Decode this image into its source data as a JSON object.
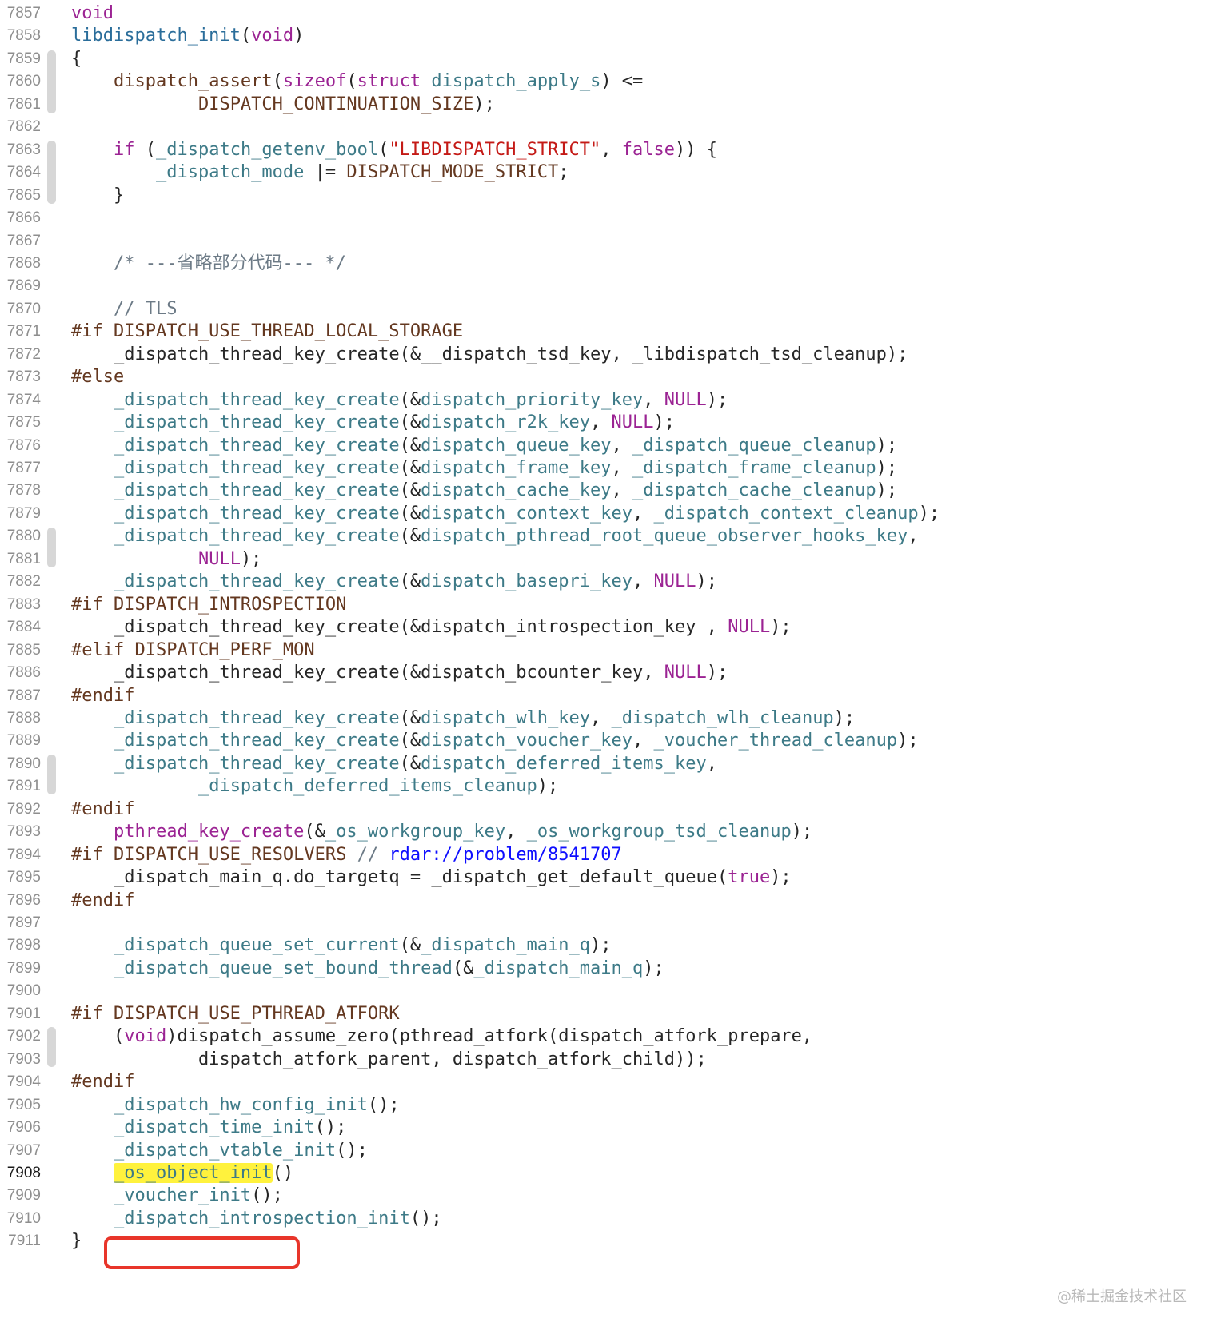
{
  "editor": {
    "current_line": "7908",
    "lines": [
      {
        "n": "7857",
        "t": [
          [
            "kw",
            "void"
          ]
        ]
      },
      {
        "n": "7858",
        "t": [
          [
            "blue",
            "libdispatch_init"
          ],
          [
            "tx",
            "("
          ],
          [
            "kw",
            "void"
          ],
          [
            "tx",
            ")"
          ]
        ]
      },
      {
        "n": "7859",
        "t": [
          [
            "tx",
            "{"
          ]
        ]
      },
      {
        "n": "7860",
        "t": [
          [
            "tx",
            "    "
          ],
          [
            "pp",
            "dispatch_assert"
          ],
          [
            "tx",
            "("
          ],
          [
            "kw",
            "sizeof"
          ],
          [
            "tx",
            "("
          ],
          [
            "kw",
            "struct"
          ],
          [
            "tx",
            " "
          ],
          [
            "fn",
            "dispatch_apply_s"
          ],
          [
            "tx",
            ") <="
          ]
        ]
      },
      {
        "n": "7861",
        "t": [
          [
            "tx",
            "            "
          ],
          [
            "pp",
            "DISPATCH_CONTINUATION_SIZE"
          ],
          [
            "tx",
            ");"
          ]
        ]
      },
      {
        "n": "7862",
        "t": []
      },
      {
        "n": "7863",
        "t": [
          [
            "tx",
            "    "
          ],
          [
            "kw",
            "if"
          ],
          [
            "tx",
            " ("
          ],
          [
            "fn",
            "_dispatch_getenv_bool"
          ],
          [
            "tx",
            "("
          ],
          [
            "str",
            "\"LIBDISPATCH_STRICT\""
          ],
          [
            "tx",
            ", "
          ],
          [
            "kw",
            "false"
          ],
          [
            "tx",
            ")) {"
          ]
        ]
      },
      {
        "n": "7864",
        "t": [
          [
            "tx",
            "        "
          ],
          [
            "fn",
            "_dispatch_mode"
          ],
          [
            "tx",
            " |= "
          ],
          [
            "pp",
            "DISPATCH_MODE_STRICT"
          ],
          [
            "tx",
            ";"
          ]
        ]
      },
      {
        "n": "7865",
        "t": [
          [
            "tx",
            "    }"
          ]
        ]
      },
      {
        "n": "7866",
        "t": []
      },
      {
        "n": "7867",
        "t": []
      },
      {
        "n": "7868",
        "t": [
          [
            "tx",
            "    "
          ],
          [
            "cm",
            "/* ---省略部分代码--- */"
          ]
        ]
      },
      {
        "n": "7869",
        "t": []
      },
      {
        "n": "7870",
        "t": [
          [
            "tx",
            "    "
          ],
          [
            "cm",
            "// TLS"
          ]
        ]
      },
      {
        "n": "7871",
        "t": [
          [
            "pp",
            "#if DISPATCH_USE_THREAD_LOCAL_STORAGE"
          ]
        ]
      },
      {
        "n": "7872",
        "t": [
          [
            "tx",
            "    _dispatch_thread_key_create(&__dispatch_tsd_key, _libdispatch_tsd_cleanup);"
          ]
        ]
      },
      {
        "n": "7873",
        "t": [
          [
            "pp",
            "#else"
          ]
        ]
      },
      {
        "n": "7874",
        "t": [
          [
            "tx",
            "    "
          ],
          [
            "fn",
            "_dispatch_thread_key_create"
          ],
          [
            "tx",
            "(&"
          ],
          [
            "fn",
            "dispatch_priority_key"
          ],
          [
            "tx",
            ", "
          ],
          [
            "kw",
            "NULL"
          ],
          [
            "tx",
            ");"
          ]
        ]
      },
      {
        "n": "7875",
        "t": [
          [
            "tx",
            "    "
          ],
          [
            "fn",
            "_dispatch_thread_key_create"
          ],
          [
            "tx",
            "(&"
          ],
          [
            "fn",
            "dispatch_r2k_key"
          ],
          [
            "tx",
            ", "
          ],
          [
            "kw",
            "NULL"
          ],
          [
            "tx",
            ");"
          ]
        ]
      },
      {
        "n": "7876",
        "t": [
          [
            "tx",
            "    "
          ],
          [
            "fn",
            "_dispatch_thread_key_create"
          ],
          [
            "tx",
            "(&"
          ],
          [
            "fn",
            "dispatch_queue_key"
          ],
          [
            "tx",
            ", "
          ],
          [
            "fn",
            "_dispatch_queue_cleanup"
          ],
          [
            "tx",
            ");"
          ]
        ]
      },
      {
        "n": "7877",
        "t": [
          [
            "tx",
            "    "
          ],
          [
            "fn",
            "_dispatch_thread_key_create"
          ],
          [
            "tx",
            "(&"
          ],
          [
            "fn",
            "dispatch_frame_key"
          ],
          [
            "tx",
            ", "
          ],
          [
            "fn",
            "_dispatch_frame_cleanup"
          ],
          [
            "tx",
            ");"
          ]
        ]
      },
      {
        "n": "7878",
        "t": [
          [
            "tx",
            "    "
          ],
          [
            "fn",
            "_dispatch_thread_key_create"
          ],
          [
            "tx",
            "(&"
          ],
          [
            "fn",
            "dispatch_cache_key"
          ],
          [
            "tx",
            ", "
          ],
          [
            "fn",
            "_dispatch_cache_cleanup"
          ],
          [
            "tx",
            ");"
          ]
        ]
      },
      {
        "n": "7879",
        "t": [
          [
            "tx",
            "    "
          ],
          [
            "fn",
            "_dispatch_thread_key_create"
          ],
          [
            "tx",
            "(&"
          ],
          [
            "fn",
            "dispatch_context_key"
          ],
          [
            "tx",
            ", "
          ],
          [
            "fn",
            "_dispatch_context_cleanup"
          ],
          [
            "tx",
            ");"
          ]
        ]
      },
      {
        "n": "7880",
        "t": [
          [
            "tx",
            "    "
          ],
          [
            "fn",
            "_dispatch_thread_key_create"
          ],
          [
            "tx",
            "(&"
          ],
          [
            "fn",
            "dispatch_pthread_root_queue_observer_hooks_key"
          ],
          [
            "tx",
            ","
          ]
        ]
      },
      {
        "n": "7881",
        "t": [
          [
            "tx",
            "            "
          ],
          [
            "kw",
            "NULL"
          ],
          [
            "tx",
            ");"
          ]
        ]
      },
      {
        "n": "7882",
        "t": [
          [
            "tx",
            "    "
          ],
          [
            "fn",
            "_dispatch_thread_key_create"
          ],
          [
            "tx",
            "(&"
          ],
          [
            "fn",
            "dispatch_basepri_key"
          ],
          [
            "tx",
            ", "
          ],
          [
            "kw",
            "NULL"
          ],
          [
            "tx",
            ");"
          ]
        ]
      },
      {
        "n": "7883",
        "t": [
          [
            "pp",
            "#if DISPATCH_INTROSPECTION"
          ]
        ]
      },
      {
        "n": "7884",
        "t": [
          [
            "tx",
            "    _dispatch_thread_key_create(&dispatch_introspection_key , "
          ],
          [
            "kw",
            "NULL"
          ],
          [
            "tx",
            ");"
          ]
        ]
      },
      {
        "n": "7885",
        "t": [
          [
            "pp",
            "#elif DISPATCH_PERF_MON"
          ]
        ]
      },
      {
        "n": "7886",
        "t": [
          [
            "tx",
            "    _dispatch_thread_key_create(&dispatch_bcounter_key, "
          ],
          [
            "kw",
            "NULL"
          ],
          [
            "tx",
            ");"
          ]
        ]
      },
      {
        "n": "7887",
        "t": [
          [
            "pp",
            "#endif"
          ]
        ]
      },
      {
        "n": "7888",
        "t": [
          [
            "tx",
            "    "
          ],
          [
            "fn",
            "_dispatch_thread_key_create"
          ],
          [
            "tx",
            "(&"
          ],
          [
            "fn",
            "dispatch_wlh_key"
          ],
          [
            "tx",
            ", "
          ],
          [
            "fn",
            "_dispatch_wlh_cleanup"
          ],
          [
            "tx",
            ");"
          ]
        ]
      },
      {
        "n": "7889",
        "t": [
          [
            "tx",
            "    "
          ],
          [
            "fn",
            "_dispatch_thread_key_create"
          ],
          [
            "tx",
            "(&"
          ],
          [
            "fn",
            "dispatch_voucher_key"
          ],
          [
            "tx",
            ", "
          ],
          [
            "fn",
            "_voucher_thread_cleanup"
          ],
          [
            "tx",
            ");"
          ]
        ]
      },
      {
        "n": "7890",
        "t": [
          [
            "tx",
            "    "
          ],
          [
            "fn",
            "_dispatch_thread_key_create"
          ],
          [
            "tx",
            "(&"
          ],
          [
            "fn",
            "dispatch_deferred_items_key"
          ],
          [
            "tx",
            ","
          ]
        ]
      },
      {
        "n": "7891",
        "t": [
          [
            "tx",
            "            "
          ],
          [
            "fn",
            "_dispatch_deferred_items_cleanup"
          ],
          [
            "tx",
            ");"
          ]
        ]
      },
      {
        "n": "7892",
        "t": [
          [
            "pp",
            "#endif"
          ]
        ]
      },
      {
        "n": "7893",
        "t": [
          [
            "tx",
            "    "
          ],
          [
            "kw",
            "pthread_key_create"
          ],
          [
            "tx",
            "(&"
          ],
          [
            "fn",
            "_os_workgroup_key"
          ],
          [
            "tx",
            ", "
          ],
          [
            "fn",
            "_os_workgroup_tsd_cleanup"
          ],
          [
            "tx",
            ");"
          ]
        ]
      },
      {
        "n": "7894",
        "t": [
          [
            "pp",
            "#if DISPATCH_USE_RESOLVERS"
          ],
          [
            "tx",
            " "
          ],
          [
            "cm",
            "// "
          ],
          [
            "url",
            "rdar://problem/8541707"
          ]
        ]
      },
      {
        "n": "7895",
        "t": [
          [
            "tx",
            "    _dispatch_main_q.do_targetq = _dispatch_get_default_queue("
          ],
          [
            "kw",
            "true"
          ],
          [
            "tx",
            ");"
          ]
        ]
      },
      {
        "n": "7896",
        "t": [
          [
            "pp",
            "#endif"
          ]
        ]
      },
      {
        "n": "7897",
        "t": []
      },
      {
        "n": "7898",
        "t": [
          [
            "tx",
            "    "
          ],
          [
            "fn",
            "_dispatch_queue_set_current"
          ],
          [
            "tx",
            "(&"
          ],
          [
            "fn",
            "_dispatch_main_q"
          ],
          [
            "tx",
            ");"
          ]
        ]
      },
      {
        "n": "7899",
        "t": [
          [
            "tx",
            "    "
          ],
          [
            "fn",
            "_dispatch_queue_set_bound_thread"
          ],
          [
            "tx",
            "(&"
          ],
          [
            "fn",
            "_dispatch_main_q"
          ],
          [
            "tx",
            ");"
          ]
        ]
      },
      {
        "n": "7900",
        "t": []
      },
      {
        "n": "7901",
        "t": [
          [
            "pp",
            "#if DISPATCH_USE_PTHREAD_ATFORK"
          ]
        ]
      },
      {
        "n": "7902",
        "t": [
          [
            "tx",
            "    ("
          ],
          [
            "kw",
            "void"
          ],
          [
            "tx",
            ")dispatch_assume_zero(pthread_atfork(dispatch_atfork_prepare,"
          ]
        ]
      },
      {
        "n": "7903",
        "t": [
          [
            "tx",
            "            dispatch_atfork_parent, dispatch_atfork_child));"
          ]
        ]
      },
      {
        "n": "7904",
        "t": [
          [
            "pp",
            "#endif"
          ]
        ]
      },
      {
        "n": "7905",
        "t": [
          [
            "tx",
            "    "
          ],
          [
            "fn",
            "_dispatch_hw_config_init"
          ],
          [
            "tx",
            "();"
          ]
        ]
      },
      {
        "n": "7906",
        "t": [
          [
            "tx",
            "    "
          ],
          [
            "fn",
            "_dispatch_time_init"
          ],
          [
            "tx",
            "();"
          ]
        ]
      },
      {
        "n": "7907",
        "t": [
          [
            "tx",
            "    "
          ],
          [
            "fn",
            "_dispatch_vtable_init"
          ],
          [
            "tx",
            "();"
          ]
        ]
      },
      {
        "n": "7908",
        "t": [
          [
            "tx",
            "    "
          ],
          [
            "fn-hl",
            "_os_object_init"
          ],
          [
            "tx",
            "()"
          ]
        ]
      },
      {
        "n": "7909",
        "t": [
          [
            "tx",
            "    "
          ],
          [
            "fn",
            "_voucher_init"
          ],
          [
            "tx",
            "();"
          ]
        ]
      },
      {
        "n": "7910",
        "t": [
          [
            "tx",
            "    "
          ],
          [
            "fn",
            "_dispatch_introspection_init"
          ],
          [
            "tx",
            "();"
          ]
        ]
      },
      {
        "n": "7911",
        "t": [
          [
            "tx",
            "}"
          ]
        ]
      }
    ]
  },
  "watermark": "@稀土掘金技术社区",
  "colors": {
    "keyword": "#9b2393",
    "function": "#3d7a87",
    "declaration": "#2a6d9a",
    "preprocessor": "#643820",
    "string": "#c41a16",
    "comment": "#6c7a86",
    "url": "#0e0eff",
    "highlight": "#fff23d",
    "marker": "#e8352a"
  }
}
